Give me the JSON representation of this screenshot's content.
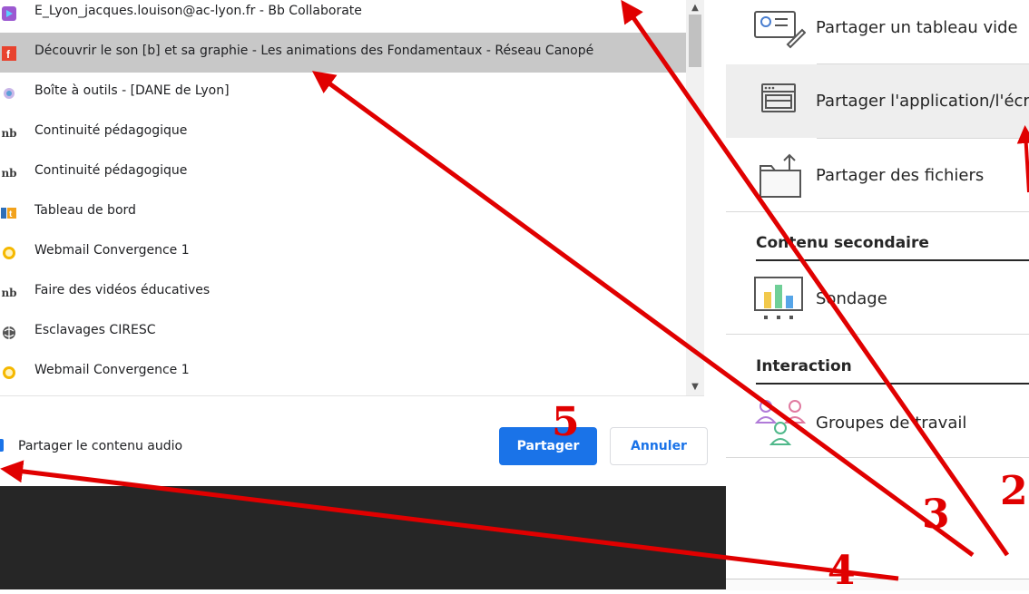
{
  "tabs": [
    {
      "title": "E_Lyon_jacques.louison@ac-lyon.fr - Bb Collaborate",
      "icon": "collaborate-icon",
      "selected": false
    },
    {
      "title": "Découvrir le son [b] et sa graphie - Les animations des Fondamentaux - Réseau Canopé",
      "icon": "facebook-icon",
      "selected": true
    },
    {
      "title": "Boîte à outils - [DANE de Lyon]",
      "icon": "dane-icon",
      "selected": false
    },
    {
      "title": "Continuité pédagogique",
      "icon": "nb-icon",
      "selected": false
    },
    {
      "title": "Continuité pédagogique",
      "icon": "nb-icon",
      "selected": false
    },
    {
      "title": "Tableau de bord",
      "icon": "tableau-icon",
      "selected": false
    },
    {
      "title": "Webmail Convergence 1",
      "icon": "webmail-icon",
      "selected": false
    },
    {
      "title": "Faire des vidéos éducatives",
      "icon": "nb-icon",
      "selected": false
    },
    {
      "title": "Esclavages CIRESC",
      "icon": "globe-icon",
      "selected": false
    },
    {
      "title": "Webmail Convergence 1",
      "icon": "webmail-icon",
      "selected": false
    }
  ],
  "dialog": {
    "audio_label": "Partager le contenu audio",
    "share_label": "Partager",
    "cancel_label": "Annuler",
    "accent": "#1a73e8"
  },
  "panel": {
    "items": {
      "blank_board": "Partager un tableau vide",
      "share_app": "Partager l'application/l'écr",
      "share_files": "Partager des fichiers",
      "poll": "Sondage",
      "groups": "Groupes de travail"
    },
    "sections": {
      "secondary": "Contenu secondaire",
      "interaction": "Interaction"
    }
  },
  "annotations": {
    "n2": "2",
    "n3": "3",
    "n4": "4",
    "n5": "5",
    "color": "#e00000"
  }
}
